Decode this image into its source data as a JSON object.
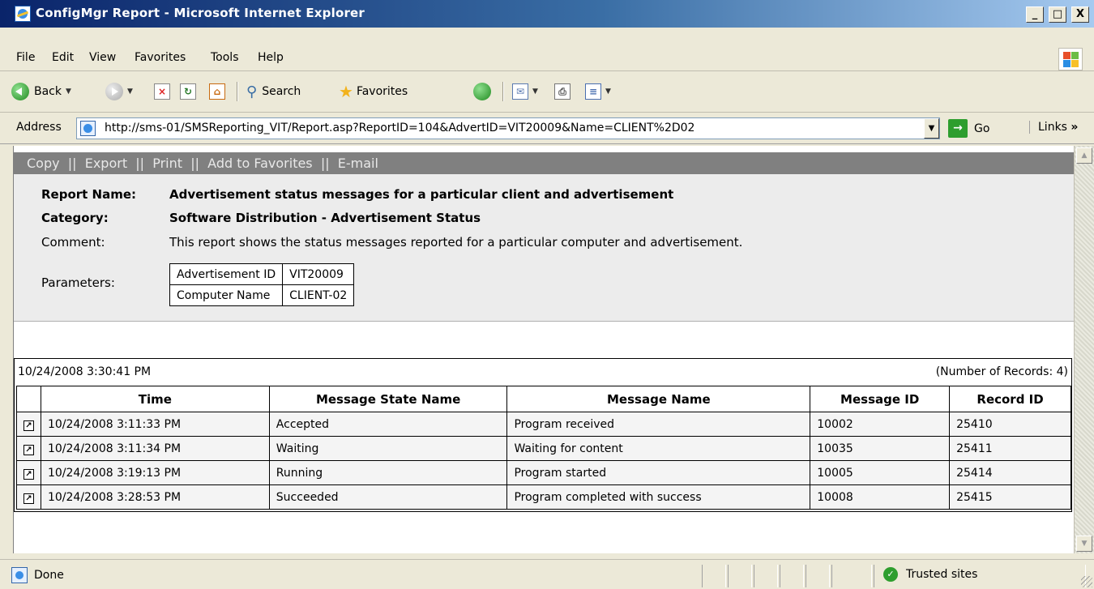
{
  "window": {
    "title": "ConfigMgr Report - Microsoft Internet Explorer",
    "min_label": "_",
    "max_label": "□",
    "close_label": "X"
  },
  "menu": [
    "File",
    "Edit",
    "View",
    "Favorites",
    "Tools",
    "Help"
  ],
  "toolbar": {
    "back_label": "Back",
    "search_label": "Search",
    "favorites_label": "Favorites"
  },
  "address": {
    "label": "Address",
    "url": "http://sms-01/SMSReporting_VIT/Report.asp?ReportID=104&AdvertID=VIT20009&Name=CLIENT%2D02",
    "go_label": "Go",
    "links_label": "Links"
  },
  "actions": [
    "Copy",
    "Export",
    "Print",
    "Add to Favorites",
    "E-mail"
  ],
  "report": {
    "name_label": "Report Name:",
    "name_value": "Advertisement status messages for a particular client and advertisement",
    "category_label": "Category:",
    "category_value": "Software Distribution - Advertisement Status",
    "comment_label": "Comment:",
    "comment_value": "This report shows the status messages reported for a particular computer and advertisement.",
    "parameters_label": "Parameters:",
    "parameters": [
      {
        "name": "Advertisement ID",
        "value": "VIT20009"
      },
      {
        "name": "Computer Name",
        "value": "CLIENT-02"
      }
    ]
  },
  "results": {
    "timestamp": "10/24/2008 3:30:41 PM",
    "record_count": "(Number of Records: 4)",
    "columns": [
      "Time",
      "Message State Name",
      "Message Name",
      "Message ID",
      "Record ID"
    ],
    "rows": [
      [
        "10/24/2008 3:11:33 PM",
        "Accepted",
        "Program received",
        "10002",
        "25410"
      ],
      [
        "10/24/2008 3:11:34 PM",
        "Waiting",
        "Waiting for content",
        "10035",
        "25411"
      ],
      [
        "10/24/2008 3:19:13 PM",
        "Running",
        "Program started",
        "10005",
        "25414"
      ],
      [
        "10/24/2008 3:28:53 PM",
        "Succeeded",
        "Program completed with success",
        "10008",
        "25415"
      ]
    ]
  },
  "status": {
    "text": "Done",
    "zone": "Trusted sites"
  }
}
